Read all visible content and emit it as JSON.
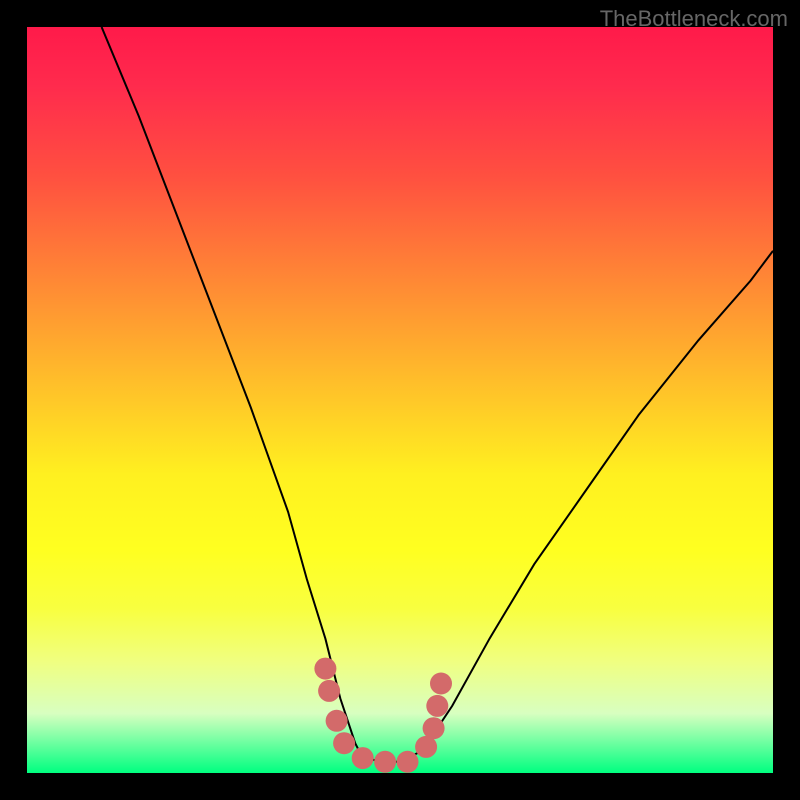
{
  "watermark": "TheBottleneck.com",
  "chart_data": {
    "type": "line",
    "title": "",
    "xlabel": "",
    "ylabel": "",
    "xlim": [
      0,
      100
    ],
    "ylim": [
      0,
      100
    ],
    "series": [
      {
        "name": "curve",
        "x": [
          10,
          15,
          20,
          25,
          30,
          35,
          37.5,
          40,
          42,
          44,
          45,
          48,
          50,
          53,
          57,
          62,
          68,
          75,
          82,
          90,
          97,
          100
        ],
        "values": [
          100,
          88,
          75,
          62,
          49,
          35,
          26,
          18,
          10,
          4,
          2,
          1.5,
          1.5,
          3,
          9,
          18,
          28,
          38,
          48,
          58,
          66,
          70
        ]
      }
    ],
    "markers": {
      "name": "highlight-dots",
      "color": "#d36a6a",
      "points": [
        {
          "x": 40.0,
          "y": 14
        },
        {
          "x": 40.5,
          "y": 11
        },
        {
          "x": 41.5,
          "y": 7
        },
        {
          "x": 42.5,
          "y": 4
        },
        {
          "x": 45.0,
          "y": 2
        },
        {
          "x": 48.0,
          "y": 1.5
        },
        {
          "x": 51.0,
          "y": 1.5
        },
        {
          "x": 53.5,
          "y": 3.5
        },
        {
          "x": 54.5,
          "y": 6
        },
        {
          "x": 55.0,
          "y": 9
        },
        {
          "x": 55.5,
          "y": 12
        }
      ]
    }
  }
}
